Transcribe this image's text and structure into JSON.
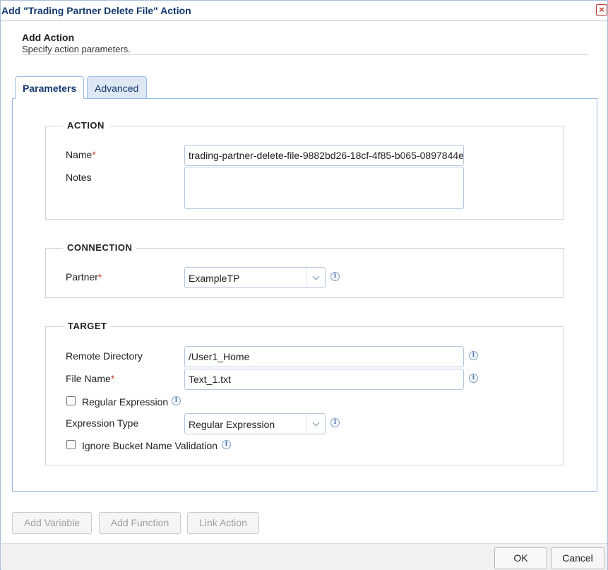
{
  "window": {
    "title": "Add \"Trading Partner Delete File\" Action",
    "close_icon": "close-icon"
  },
  "header": {
    "title": "Add Action",
    "subtitle": "Specify action parameters."
  },
  "tabs": [
    {
      "label": "Parameters",
      "active": true
    },
    {
      "label": "Advanced",
      "active": false
    }
  ],
  "action": {
    "legend": "ACTION",
    "name_label": "Name",
    "name_value": "trading-partner-delete-file-9882bd26-18cf-4f85-b065-0897844e",
    "notes_label": "Notes",
    "notes_value": ""
  },
  "connection": {
    "legend": "CONNECTION",
    "partner_label": "Partner",
    "partner_value": "ExampleTP"
  },
  "target": {
    "legend": "TARGET",
    "remote_dir_label": "Remote Directory",
    "remote_dir_value": "/User1_Home",
    "file_name_label": "File Name",
    "file_name_value": "Text_1.txt",
    "regex_label": "Regular Expression",
    "regex_checked": false,
    "expr_type_label": "Expression Type",
    "expr_type_value": "Regular Expression",
    "ignore_bucket_label": "Ignore Bucket Name Validation",
    "ignore_bucket_checked": false
  },
  "required_marker": "*",
  "info_glyph": "i",
  "close_glyph": "×",
  "toolbar": {
    "add_variable": "Add Variable",
    "add_function": "Add Function",
    "link_action": "Link Action"
  },
  "footer": {
    "ok": "OK",
    "cancel": "Cancel"
  },
  "colors": {
    "title": "#15396e",
    "required": "#c0392b",
    "border_accent": "#99bbe8"
  }
}
